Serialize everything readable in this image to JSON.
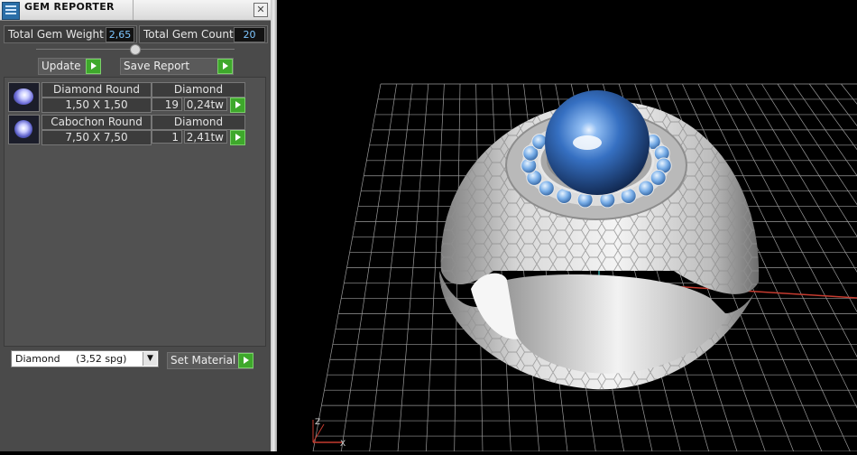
{
  "window": {
    "title": "GEM REPORTER"
  },
  "stats": {
    "weight_label": "Total Gem Weight",
    "weight_value": "2,65",
    "count_label": "Total Gem Count",
    "count_value": "20"
  },
  "actions": {
    "update_label": "Update",
    "save_label": "Save Report"
  },
  "gems": [
    {
      "shape": "Diamond Round",
      "material": "Diamond",
      "size": "1,50 X 1,50",
      "count": "19",
      "weight": "0,24tw"
    },
    {
      "shape": "Cabochon Round",
      "material": "Diamond",
      "size": "7,50 X 7,50",
      "count": "1",
      "weight": "2,41tw"
    }
  ],
  "material_select": {
    "value": "Diamond     (3,52 spg)"
  },
  "set_material_label": "Set Material",
  "viewport": {
    "axis_x_label": "X",
    "axis_z_label": "Z"
  },
  "colors": {
    "accent_play": "#3ea82b",
    "value_text": "#7ec6ff",
    "stone_blue": "#2f66b8"
  }
}
